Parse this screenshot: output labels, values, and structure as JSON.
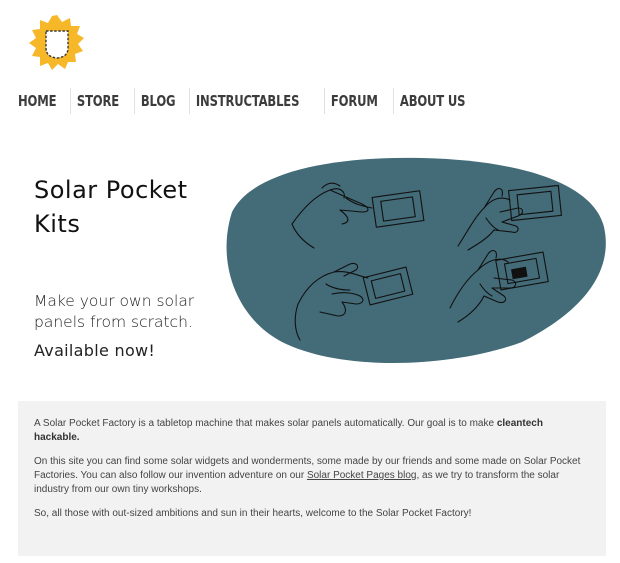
{
  "nav": {
    "items": [
      "HOME",
      "STORE",
      "BLOG",
      "INSTRUCTABLES",
      "FORUM",
      "ABOUT US"
    ]
  },
  "hero": {
    "title_line1": "Solar Pocket",
    "title_line2": "Kits",
    "subtitle_line1": "Make your own solar",
    "subtitle_line2": "panels from scratch.",
    "cta": "Available now!"
  },
  "intro": {
    "p1_text": "A Solar Pocket Factory is a tabletop machine that makes solar panels automatically.  Our goal is to make ",
    "p1_bold": "cleantech hackable.",
    "p2_before": "On this site you can find some solar widgets and wonderments, some made by our friends and some made on Solar Pocket Factories.  You can also follow our invention adventure on our ",
    "p2_link": "Solar Pocket Pages blog",
    "p2_after": ", as we try to transform the solar industry from our own tiny workshops.",
    "p3": "So, all those with out-sized ambitions and sun in their hearts, welcome to the Solar Pocket Factory!"
  },
  "colors": {
    "logo_sun": "#f6b829",
    "blob": "#436b78",
    "intro_bg": "#f2f2f2"
  },
  "icons": {
    "logo": "sun-pocket-logo"
  }
}
